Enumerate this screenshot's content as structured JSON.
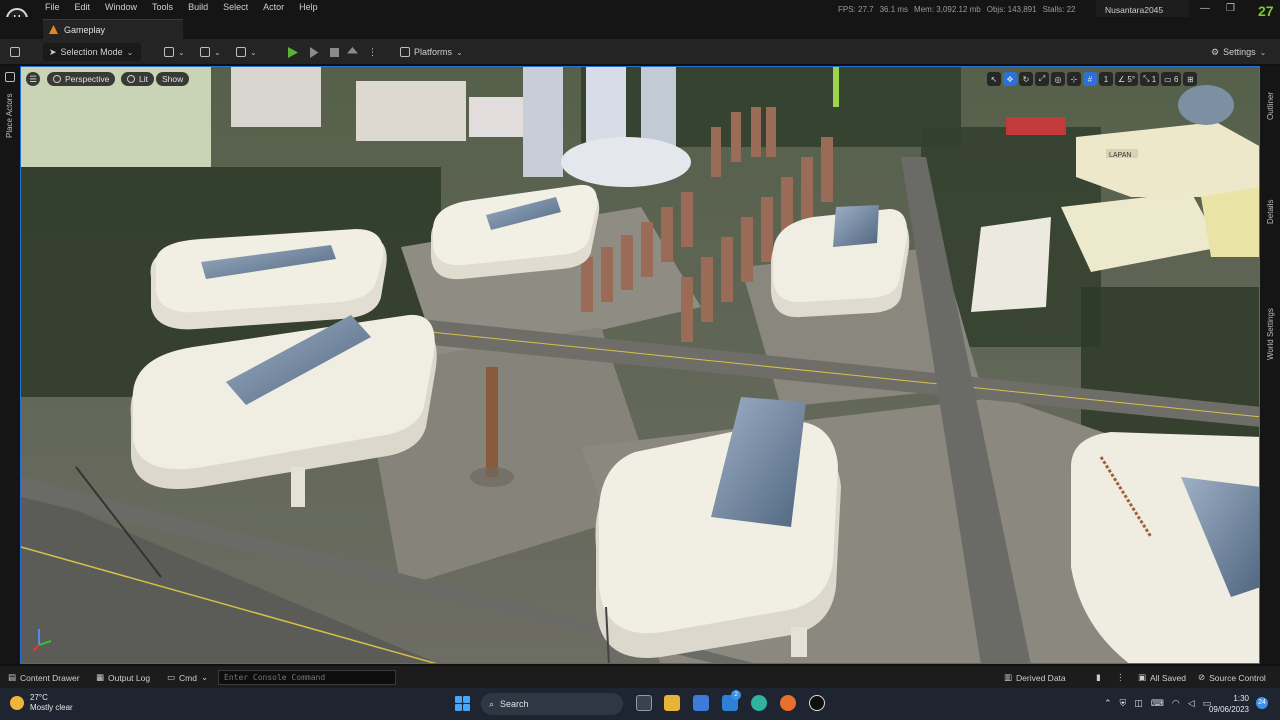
{
  "window": {
    "menu": [
      "File",
      "Edit",
      "Window",
      "Tools",
      "Build",
      "Select",
      "Actor",
      "Help"
    ],
    "stats": {
      "fps": "FPS: 27.7",
      "frame_time": "36.1 ms",
      "mem": "Mem: 3,092.12 mb",
      "objs": "Objs: 143,891",
      "stalls": "Stalls: 22"
    },
    "project_name": "Nusantara2045",
    "version_badge": "27",
    "controls": {
      "minimize": "—",
      "maximize": "❐",
      "close": "✕"
    }
  },
  "tabs": [
    {
      "label": "Gameplay"
    }
  ],
  "toolbar": {
    "selection_mode": "Selection Mode",
    "platforms": "Platforms",
    "settings": "Settings"
  },
  "side_panels": {
    "left": "Place Actors",
    "right": [
      "Outliner",
      "Details",
      "World Settings"
    ]
  },
  "viewport": {
    "perspective": "Perspective",
    "lit": "Lit",
    "show": "Show",
    "snap_rotation": "5°",
    "snap_scale": "1",
    "camera_speed": "6",
    "grid_size": "1",
    "building_sign": "LAPAN"
  },
  "statusbar": {
    "content_drawer": "Content Drawer",
    "output_log": "Output Log",
    "cmd": "Cmd",
    "console_placeholder": "Enter Console Command",
    "derived_data": "Derived Data",
    "all_saved": "All Saved",
    "source_control": "Source Control"
  },
  "taskbar": {
    "weather_temp": "27°C",
    "weather_desc": "Mostly clear",
    "search_label": "Search",
    "time": "1:30",
    "date": "09/06/2023",
    "notification_count": "24",
    "mail_badge": "2"
  },
  "colors": {
    "accent_blue": "#2e6fd8",
    "play_green": "#5ab337",
    "version_green": "#7fc832"
  }
}
